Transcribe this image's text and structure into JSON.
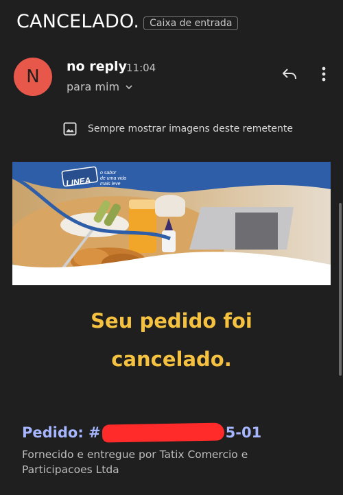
{
  "email": {
    "subject": "CANCELADO.",
    "label": "Caixa de entrada",
    "sender": {
      "initial": "N",
      "name": "no reply",
      "time": "11:04",
      "recipient": "para mim"
    },
    "images_notice": "Sempre mostrar imagens deste remetente",
    "banner": {
      "logo_text": "LINEA",
      "tagline": [
        "o sabor",
        "de uma vida",
        "mais leve"
      ]
    },
    "body": {
      "headline_line1": "Seu pedido foi",
      "headline_line2": "cancelado.",
      "order_label": "Pedido: #",
      "order_suffix": "5-01",
      "fulfilled_by": "Fornecido e entregue por Tatix Comercio e Participacoes Ltda"
    }
  },
  "icons": {
    "reply": "reply-icon",
    "more": "more-vert-icon",
    "image": "image-icon",
    "chevron": "chevron-down-icon"
  },
  "colors": {
    "background": "#1f1f1f",
    "avatar": "#e8584a",
    "headline": "#f5c141",
    "order_label": "#a7b7ff",
    "redaction": "#ff2a2a",
    "banner_blue": "#2f5ea8"
  }
}
